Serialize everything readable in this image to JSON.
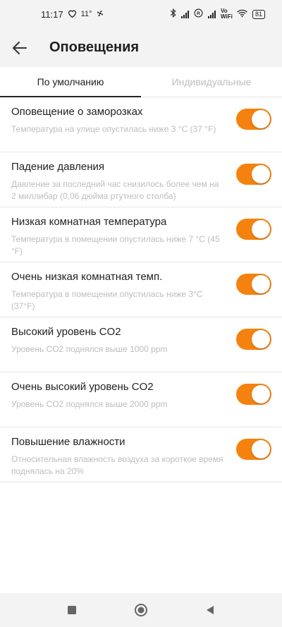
{
  "status": {
    "time": "11:17",
    "temp": "11°",
    "vowifi": "Vo WiFi",
    "battery": "81"
  },
  "appbar": {
    "title": "Оповещения"
  },
  "tabs": [
    {
      "label": "По умолчанию",
      "active": true
    },
    {
      "label": "Индивидуальные",
      "active": false
    }
  ],
  "alerts": [
    {
      "title": "Оповещение о заморозках",
      "desc": "Температура на улице опустилась ниже 3 °C (37 °F)",
      "enabled": true
    },
    {
      "title": "Падение давления",
      "desc": "Давление за последний час снизилось более чем на 2 миллибар (0,06 дюйма ртутного столба)",
      "enabled": true
    },
    {
      "title": "Низкая комнатная температура",
      "desc": "Температура в помещении опустилась ниже 7 °C (45 °F)",
      "enabled": true
    },
    {
      "title": "Очень низкая комнатная темп.",
      "desc": "Температура в помещении опустилась ниже 3°C (37°F)",
      "enabled": true
    },
    {
      "title": "Высокий уровень CO2",
      "desc": "Уровень CO2 поднялся выше 1000 ppm",
      "enabled": true
    },
    {
      "title": "Очень высокий уровень CO2",
      "desc": "Уровень CO2 поднялся выше 2000 ppm",
      "enabled": true
    },
    {
      "title": "Повышение влажности",
      "desc": "Относительная влажность воздуха за короткое время поднялась на 20%",
      "enabled": true
    }
  ],
  "colors": {
    "accent": "#f5820e",
    "bar_background": "#f3f3f3",
    "muted_text": "#bdbdbd"
  }
}
